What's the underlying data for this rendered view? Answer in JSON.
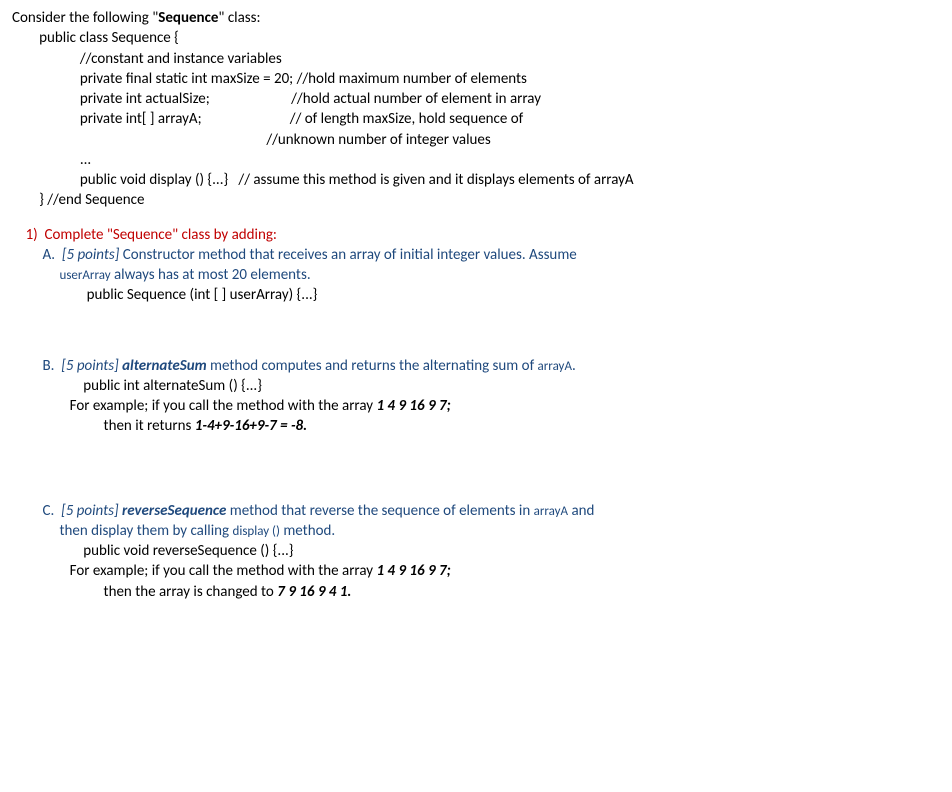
{
  "intro": {
    "prefix": "Consider the following \"",
    "seq": "Sequence",
    "suffix": "\" class:"
  },
  "classcode": {
    "l1": "        public class Sequence {",
    "l2": "                    //constant and instance variables",
    "l3": "                    private final static int maxSize = 20; //hold maximum number of elements",
    "l4": "                    private int actualSize;                        //hold actual number of element in array",
    "l5": "                    private int[ ] arrayA;                          // of length maxSize, hold sequence of",
    "l6": "                                                                           //unknown number of integer values",
    "l7": "                    ...",
    "l8": "                    public void display () {...}   // assume this method is given and it displays elements of arrayA",
    "l9": "",
    "l10": "        } //end Sequence"
  },
  "q1": {
    "num": "    1)  ",
    "text": "Complete \"Sequence\" class by adding:"
  },
  "A": {
    "label": "         A.  ",
    "points": "[5 points] ",
    "text1": "Constructor method that receives an array of initial integer values. Assume",
    "subline_prefix": "              ",
    "user": "userArray",
    "subline_rest": " always has at most 20 elements.",
    "sig": "                      public Sequence (int [ ] userArray) {...}"
  },
  "B": {
    "label": "         B.  ",
    "points": "[5 points] ",
    "methname": "alternateSum",
    "text1": " method computes and returns the alternating sum of ",
    "arrA": "arrayA",
    "dot": ".",
    "sig": "                     public int alternateSum () {...}",
    "ex_prefix": "                 For example; if you call the method with the array ",
    "ex_arr": "1 4 9 16 9 7;",
    "ret_prefix": "                           then it returns ",
    "ret_val": "1-4+9-16+9-7 = -8."
  },
  "C": {
    "label": "         C.  ",
    "points": "[5 points] ",
    "methname": "reverseSequence",
    "text1": " method that reverse the sequence of elements in ",
    "arrA": "arrayA",
    "and": " and",
    "line2_prefix": "              then display them by calling ",
    "disp": "display ()",
    "line2_suffix": " method.",
    "sig": "                     public void reverseSequence () {...}",
    "ex_prefix": "                 For example; if you call the method with the array ",
    "ex_arr": "1 4 9 16 9 7;",
    "ret_prefix": "                           then the array is changed to ",
    "ret_val": "7 9 16 9 4 1."
  }
}
